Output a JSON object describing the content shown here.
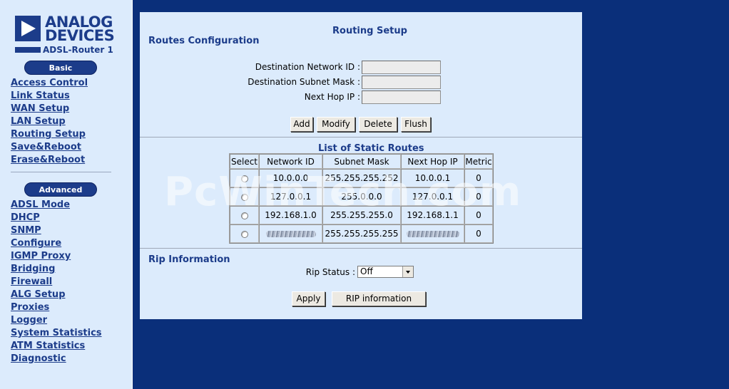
{
  "logo": {
    "brand_line1": "ANALOG",
    "brand_line2": "DEVICES",
    "model": "ADSL-Router 1"
  },
  "sidebar": {
    "basic_label": "Basic",
    "basic_items": [
      "Access Control",
      "Link Status",
      "WAN Setup",
      "LAN Setup",
      "Routing Setup",
      "Save&Reboot",
      "Erase&Reboot"
    ],
    "advanced_label": "Advanced",
    "advanced_items": [
      "ADSL Mode",
      "DHCP",
      "SNMP",
      "Configure",
      "IGMP Proxy",
      "Bridging",
      "Firewall",
      "ALG Setup",
      "Proxies",
      "Logger",
      "System Statistics",
      "ATM Statistics",
      "Diagnostic"
    ]
  },
  "page": {
    "title": "Routing Setup",
    "routes_config_title": "Routes Configuration",
    "dest_network_label": "Destination Network ID :",
    "dest_network_value": "",
    "dest_mask_label": "Destination Subnet Mask :",
    "dest_mask_value": "",
    "next_hop_label": "Next Hop IP :",
    "next_hop_value": "",
    "buttons": {
      "add": "Add",
      "modify": "Modify",
      "delete": "Delete",
      "flush": "Flush"
    },
    "static_routes_title": "List of Static Routes",
    "table_headers": [
      "Select",
      "Network ID",
      "Subnet Mask",
      "Next Hop IP",
      "Metric"
    ],
    "routes": [
      {
        "network": "10.0.0.0",
        "mask": "255.255.255.252",
        "hop": "10.0.0.1",
        "metric": "0"
      },
      {
        "network": "127.0.0.1",
        "mask": "255.0.0.0",
        "hop": "127.0.0.1",
        "metric": "0"
      },
      {
        "network": "192.168.1.0",
        "mask": "255.255.255.0",
        "hop": "192.168.1.1",
        "metric": "0"
      },
      {
        "network": "",
        "mask": "255.255.255.255",
        "hop": "",
        "metric": "0"
      }
    ],
    "rip_title": "Rip Information",
    "rip_status_label": "Rip Status :",
    "rip_status_value": "Off",
    "apply_label": "Apply",
    "rip_info_label": "RIP information"
  },
  "watermark": "PcWinTech.com"
}
